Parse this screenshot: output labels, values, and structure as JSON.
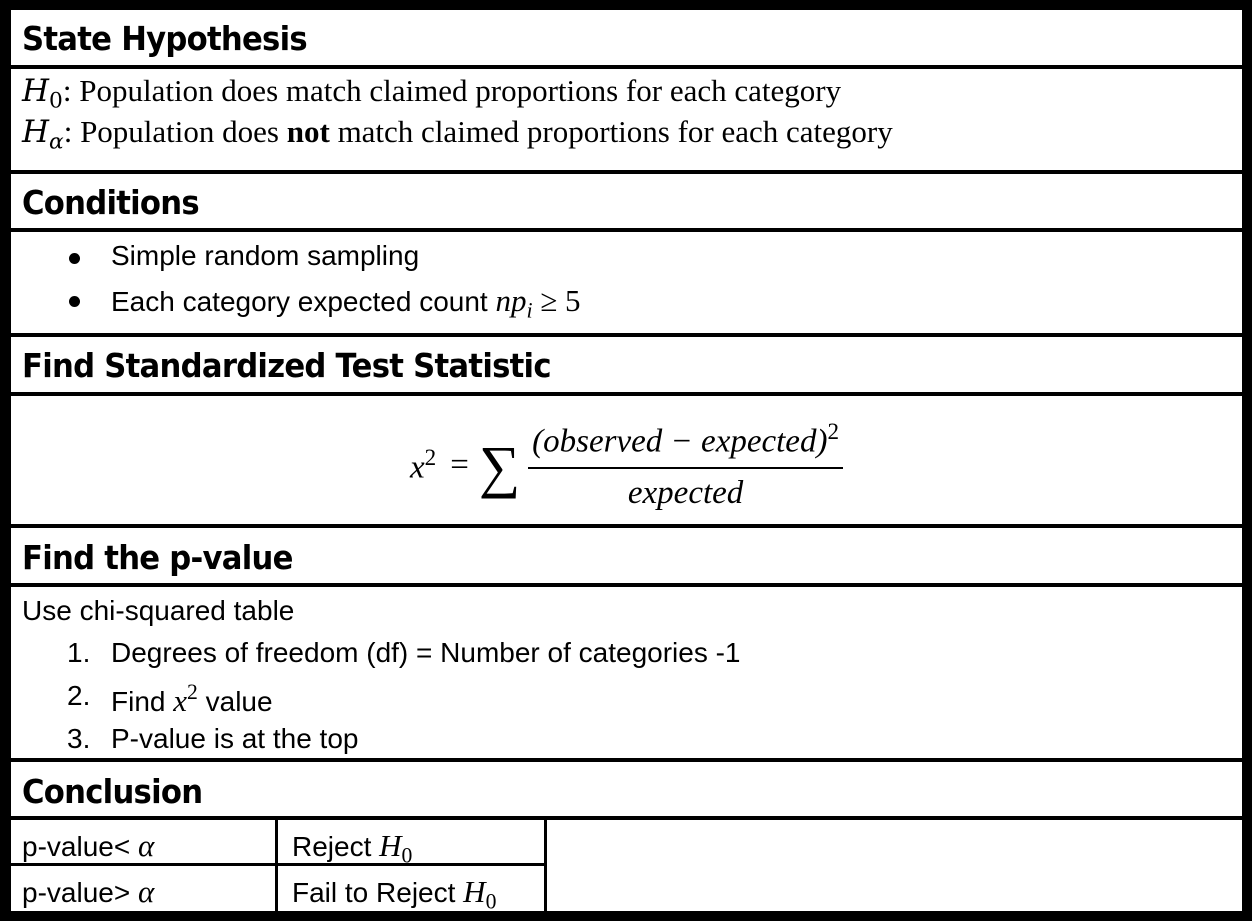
{
  "sections": {
    "hypothesis": {
      "title": "State Hypothesis",
      "h0": {
        "symbol": "H",
        "subscript": "0",
        "text": ": Population does match claimed proportions for each category"
      },
      "ha": {
        "symbol": "H",
        "subscript": "α",
        "text_before": ": Population does ",
        "bold": "not",
        "text_after": " match claimed proportions for each category"
      }
    },
    "conditions": {
      "title": "Conditions",
      "items": [
        {
          "text": "Simple random sampling"
        },
        {
          "text": "Each category expected count ",
          "math": "np",
          "math_sub": "i",
          "math_tail": " ≥ 5"
        }
      ]
    },
    "statistic": {
      "title": "Find Standardized Test Statistic",
      "formula": {
        "lhs": "x",
        "lhs_exp": "2",
        "equals": "=",
        "sigma": "∑",
        "numerator": "(observed − expected)",
        "numerator_exp": "2",
        "denominator": "expected"
      }
    },
    "pvalue": {
      "title": "Find the p-value",
      "intro": "Use chi-squared table",
      "steps": [
        {
          "num": "1.",
          "text": "Degrees of freedom (df) = Number of categories -1"
        },
        {
          "num": "2.",
          "text_before": "Find ",
          "math": "x",
          "math_exp": "2",
          "text_after": " value"
        },
        {
          "num": "3.",
          "text": "P-value is at the top"
        }
      ]
    },
    "conclusion": {
      "title": "Conclusion",
      "rows": [
        {
          "condition": "p-value",
          "op": "<",
          "alpha": "α",
          "result": "Reject ",
          "h": "H",
          "h_sub": "0"
        },
        {
          "condition": "p-value",
          "op": ">",
          "alpha": "α",
          "result": "Fail to Reject ",
          "h": "H",
          "h_sub": "0"
        }
      ]
    }
  }
}
